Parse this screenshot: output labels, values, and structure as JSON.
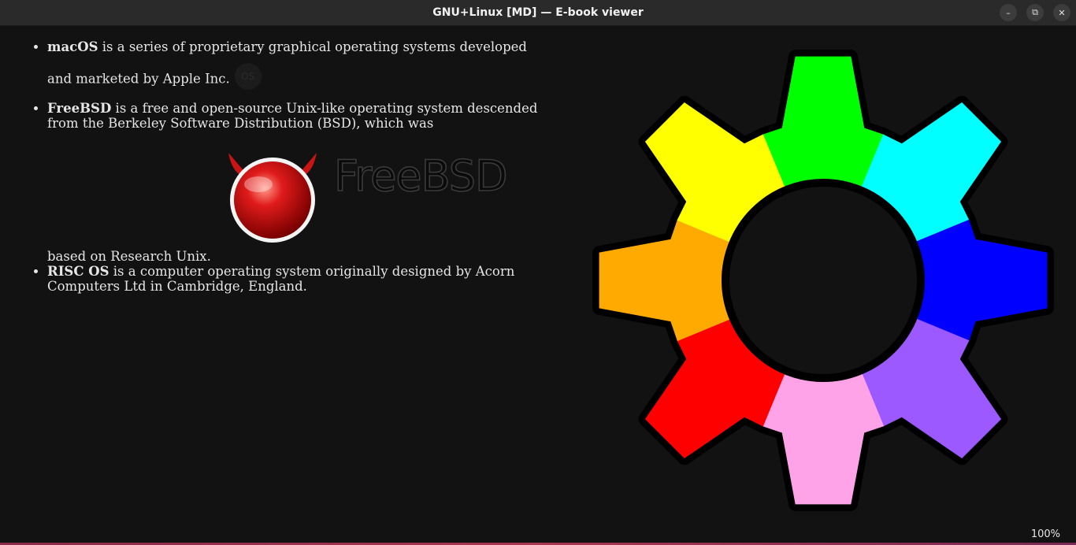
{
  "window": {
    "title": "GNU+Linux [MD] — E-book viewer",
    "buttons": [
      "minimize-icon",
      "restore-icon",
      "close-icon"
    ]
  },
  "content": {
    "items": [
      {
        "name": "macOS",
        "text_line1": " is a series of proprietary graphical operating systems developed",
        "text_line2": "and marketed by Apple Inc."
      },
      {
        "name": "FreeBSD",
        "text_before_logo": " is a free and open-source Unix-like operating system descended from the Berkeley Software Distribution (BSD), which was",
        "logo_word": "FreeBSD",
        "text_after_logo": "based on Research Unix."
      },
      {
        "name": "RISC OS",
        "text": " is a computer operating system originally designed by Acorn Computers Ltd in Cambridge, England."
      }
    ],
    "macos_logo_text": "OS"
  },
  "status": {
    "zoom": "100%"
  },
  "colors": {
    "background": "#121212",
    "gear_segments": [
      "#00ff00",
      "#00ffff",
      "#0000ff",
      "#9b59ff",
      "#ffa3e8",
      "#ff0000",
      "#ffaa00",
      "#ffff00"
    ]
  }
}
